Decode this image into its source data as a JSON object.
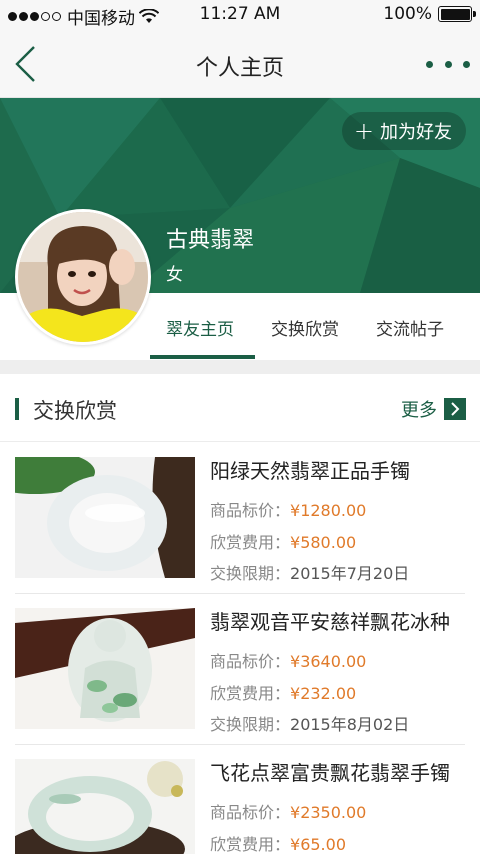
{
  "status_bar": {
    "carrier": "中国移动",
    "time": "11:27 AM",
    "battery": "100%"
  },
  "nav": {
    "title": "个人主页"
  },
  "profile": {
    "add_friend": "加为好友",
    "name": "古典翡翠",
    "gender": "女"
  },
  "tabs": [
    "翠友主页",
    "交换欣赏",
    "交流帖子"
  ],
  "section": {
    "title": "交换欣赏",
    "more": "更多"
  },
  "items": [
    {
      "title": "阳绿天然翡翠正品手镯",
      "price_label": "商品标价：",
      "price": "¥1280.00",
      "fee_label": "欣赏费用：",
      "fee": "¥580.00",
      "deadline_label": "交换限期：",
      "deadline": "2015年7月20日"
    },
    {
      "title": "翡翠观音平安慈祥飘花冰种",
      "price_label": "商品标价：",
      "price": "¥3640.00",
      "fee_label": "欣赏费用：",
      "fee": "¥232.00",
      "deadline_label": "交换限期：",
      "deadline": "2015年8月02日"
    },
    {
      "title": "飞花点翠富贵飘花翡翠手镯",
      "price_label": "商品标价：",
      "price": "¥2350.00",
      "fee_label": "欣赏费用：",
      "fee": "¥65.00",
      "deadline_label": "交换限期：",
      "deadline": ""
    }
  ],
  "colors": {
    "brand_green": "#1b5e45",
    "price_orange": "#e07a2a"
  }
}
